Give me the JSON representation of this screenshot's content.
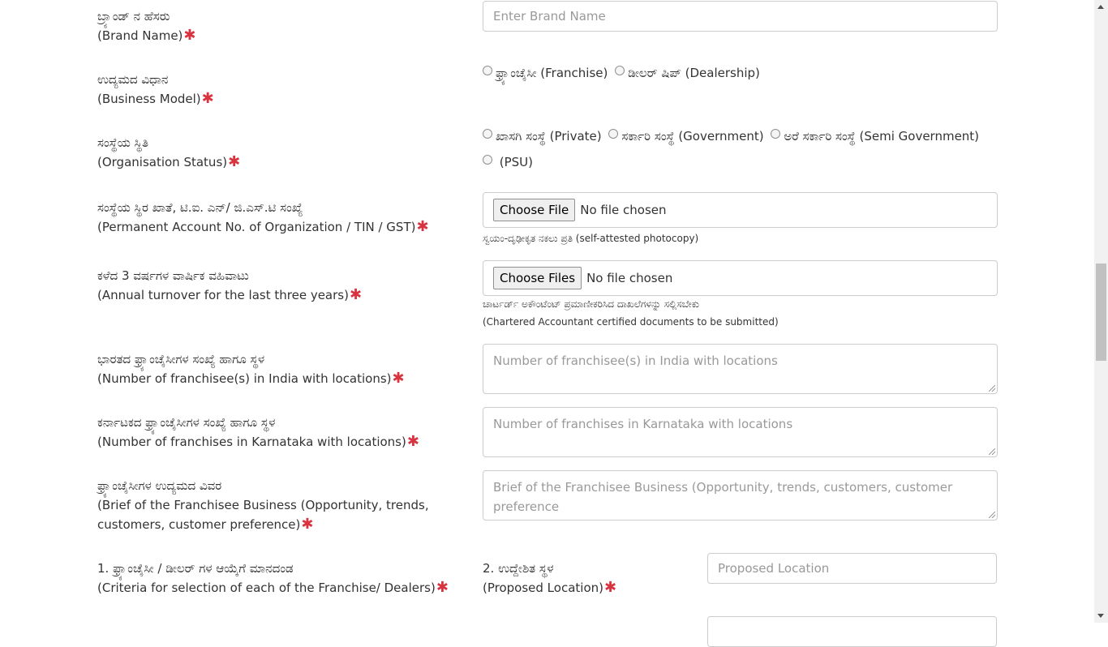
{
  "fields": {
    "brand_name": {
      "kn": "ಬ್ರ್ಯಾಂಡ್ ನ ಹೆಸರು",
      "en": "(Brand Name)",
      "placeholder": "Enter Brand Name"
    },
    "business_model": {
      "kn": "ಉದ್ಯಮದ ವಿಧಾನ",
      "en": "(Business Model)",
      "options": [
        "ಫ್ರ್ಯಾಂಚೈಸೀ (Franchise)",
        "ಡೀಲರ್ ಷಿಪ್ (Dealership)"
      ]
    },
    "org_status": {
      "kn": "ಸಂಸ್ಥೆಯ ಸ್ಥಿತಿ",
      "en": "(Organisation Status)",
      "options": [
        "ಖಾಸಗಿ ಸಂಸ್ಥೆ (Private)",
        "ಸರ್ಕಾರಿ ಸಂಸ್ಥೆ (Government)",
        "ಅರೆ ಸರ್ಕಾರಿ ಸಂಸ್ಥೆ (Semi Government)",
        " (PSU)"
      ]
    },
    "pan": {
      "kn": "ಸಂಸ್ಥೆಯ ಸ್ಥಿರ ಖಾತೆ, ಟಿ.ಐ. ಎನ್/ ಜಿ.ಎಸ್.ಟಿ ಸಂಖ್ಯೆ",
      "en": "(Permanent Account No. of Organization / TIN / GST)",
      "button": "Choose File",
      "status": "No file chosen",
      "help": "ಸ್ವಯಂ-ದೃಢೀಕೃತ ನಕಲು ಪ್ರತಿ (self-attested photocopy)"
    },
    "turnover": {
      "kn": "ಕಳೆದ 3 ವರ್ಷಗಳ ವಾರ್ಷಿಕ ವಹಿವಾಟು",
      "en": "(Annual turnover for the last three years)",
      "button": "Choose Files",
      "status": "No file chosen",
      "help1": "ಚಾರ್ಟರ್ಡ್ ಅಕೌಂಟೆಂಟ್ ಪ್ರಮಾಣೀಕರಿಸಿದ ದಾಖಲೆಗಳನ್ನು ಸಲ್ಲಿಸಬೇಕು",
      "help2": "(Chartered Accountant certified documents to be submitted)"
    },
    "india_franchisees": {
      "kn": "ಭಾರತದ ಫ್ರ್ಯಾಂಚೈಸೀಗಳ ಸಂಖ್ಯೆ ಹಾಗೂ ಸ್ಥಳ",
      "en": "(Number of franchisee(s) in India with locations)",
      "placeholder": "Number of franchisee(s) in India with locations"
    },
    "karnataka_franchises": {
      "kn": "ಕರ್ನಾಟಕದ ಫ್ರ್ಯಾಂಚೈಸೀಗಳ ಸಂಖ್ಯೆ ಹಾಗೂ ಸ್ಥಳ",
      "en": "(Number of franchises in Karnataka with locations)",
      "placeholder": "Number of franchises in Karnataka with locations"
    },
    "brief": {
      "kn": "ಫ್ರ್ಯಾಂಚೈಸೀಗಳ ಉದ್ಯಮದ ವಿವರ",
      "en1": "(Brief of the Franchisee Business (Opportunity, trends,",
      "en2": "customers, customer preference)",
      "placeholder1": "Brief of the Franchisee Business (Opportunity, trends, customers, customer",
      "placeholder2": "preference"
    },
    "criteria": {
      "kn": "1. ಫ್ರ್ಯಾಂಚೈಸೀ / ಡೀಲರ್ ಗಳ ಆಯ್ಕೆಗೆ ಮಾನದಂಡ",
      "en": "(Criteria for selection of each of the Franchise/ Dealers)"
    },
    "proposed_location": {
      "kn": "2. ಉದ್ದೇಶಿತ ಸ್ಥಳ",
      "en": "(Proposed Location)",
      "placeholder": "Proposed Location"
    }
  },
  "required_mark": "✱",
  "colors": {
    "required": "#d9333f",
    "border": "#cccccc",
    "placeholder": "#999999"
  }
}
